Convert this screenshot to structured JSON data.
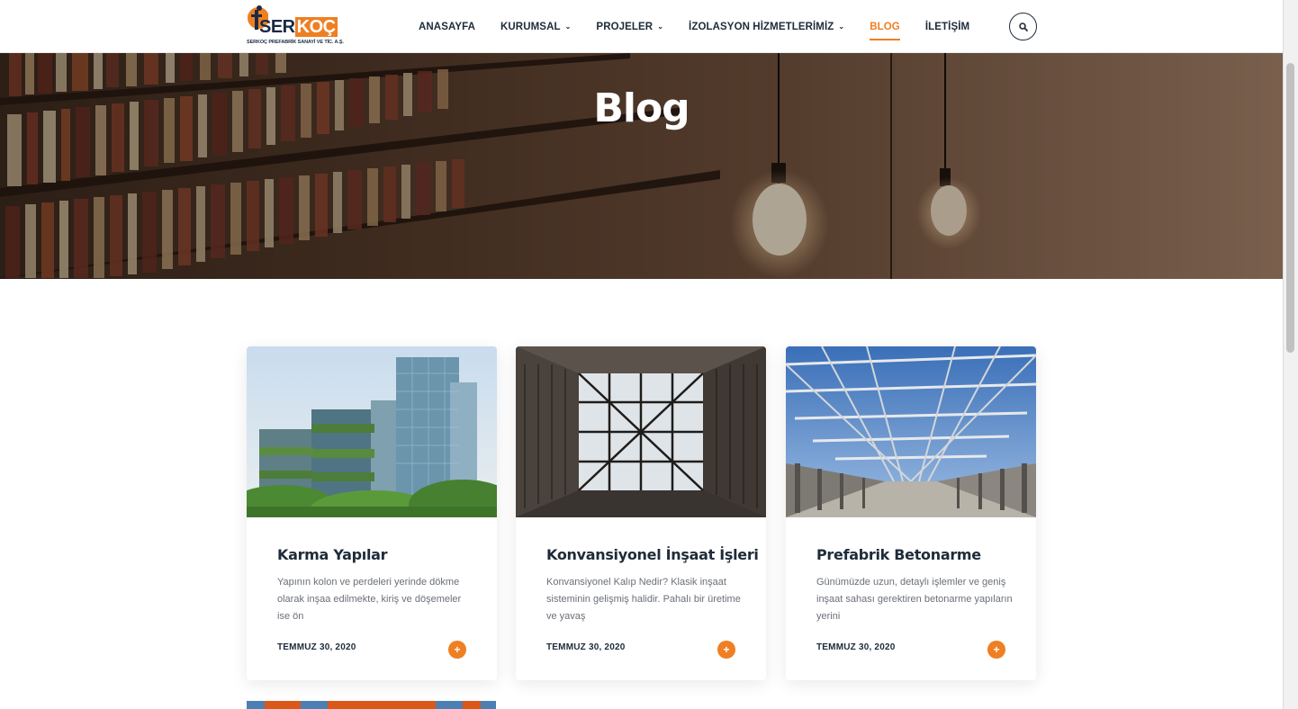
{
  "header": {
    "logo": {
      "word_ser": "SER",
      "word_koc": "KOÇ",
      "tagline": "SERKOÇ PREFABRİK SANAYİ VE TİC. A.Ş."
    },
    "nav": [
      {
        "label": "ANASAYFA",
        "has_dropdown": false,
        "active": false
      },
      {
        "label": "KURUMSAL",
        "has_dropdown": true,
        "active": false
      },
      {
        "label": "PROJELER",
        "has_dropdown": true,
        "active": false
      },
      {
        "label": "İZOLASYON HİZMETLERİMİZ",
        "has_dropdown": true,
        "active": false
      },
      {
        "label": "BLOG",
        "has_dropdown": false,
        "active": true
      },
      {
        "label": "İLETİŞİM",
        "has_dropdown": false,
        "active": false
      }
    ],
    "search_icon": "search-icon"
  },
  "hero": {
    "title": "Blog"
  },
  "posts": [
    {
      "title": "Karma Yapılar",
      "excerpt": "Yapının kolon ve perdeleri yerinde dökme olarak inşaa edilmekte, kiriş ve döşemeler ise ön",
      "date": "TEMMUZ 30, 2020",
      "more_label": "+"
    },
    {
      "title": "Konvansiyonel İnşaat İşleri",
      "excerpt": "Konvansiyonel Kalıp Nedir? Klasik inşaat sisteminin gelişmiş halidir. Pahalı bir üretime ve yavaş",
      "date": "TEMMUZ 30, 2020",
      "more_label": "+"
    },
    {
      "title": "Prefabrik Betonarme",
      "excerpt": "Günümüzde uzun, detaylı işlemler ve geniş inşaat sahası gerektiren betonarme yapıların yerini",
      "date": "TEMMUZ 30, 2020",
      "more_label": "+"
    }
  ],
  "colors": {
    "accent": "#ee7f22",
    "text_dark": "#1e2b3a",
    "text_muted": "#6a6f77"
  }
}
